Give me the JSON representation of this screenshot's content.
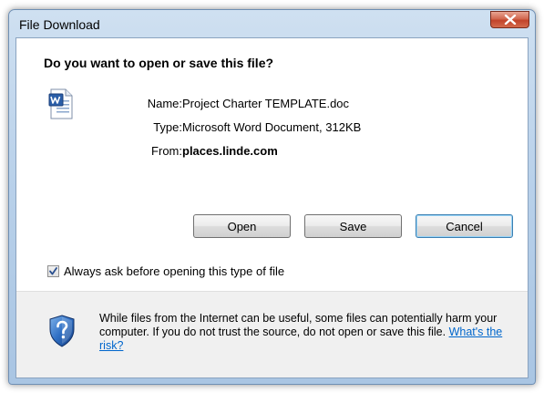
{
  "window": {
    "title": "File Download",
    "close_glyph": "X"
  },
  "dialog": {
    "heading": "Do you want to open or save this file?",
    "file_icon": "word-document-icon",
    "fields": {
      "name_label": "Name:",
      "name_value": "Project Charter TEMPLATE.doc",
      "type_label": "Type:",
      "type_value": "Microsoft Word Document, 312KB",
      "from_label": "From:",
      "from_value": "places.linde.com"
    },
    "buttons": {
      "open": "Open",
      "save": "Save",
      "cancel": "Cancel"
    },
    "checkbox": {
      "label": "Always ask before opening this type of file",
      "checked": true
    },
    "warning": {
      "icon": "security-shield-question-icon",
      "text": "While files from the Internet can be useful, some files can potentially harm your computer. If you do not trust the source, do not open or save this file.",
      "link": "What's the risk?"
    }
  },
  "colors": {
    "title_bar": "#b9d1ea",
    "close_button": "#c2432a",
    "link": "#0066cc",
    "footer_bg": "#f0f0f0"
  }
}
